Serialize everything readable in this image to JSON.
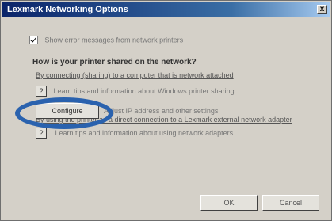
{
  "window": {
    "title": "Lexmark Networking Options",
    "close_label": "x"
  },
  "options": {
    "show_messages_label": "Show error messages from network printers",
    "question": "How is your printer shared on the network?",
    "shared_computer_link": "By connecting (sharing) to a computer that is network attached",
    "help_btn_label": "?",
    "wireless_help_text": "Learn tips and information about Windows printer sharing",
    "direct_connection_link": "By using the printer as a direct connection to a Lexmark external network adapter",
    "configure_label": "Configure",
    "configure_desc": "Adjust IP address and other settings",
    "adapter_help_text": "Learn tips and information about using network adapters"
  },
  "footer": {
    "ok_label": "OK",
    "cancel_label": "Cancel"
  },
  "colors": {
    "titlebar": "#0a246a",
    "dialog_bg": "#d4d0c8",
    "highlight": "#2a62ae"
  },
  "icons": {
    "checkbox": "checkmark-icon",
    "close": "close-icon",
    "help": "question-icon"
  }
}
